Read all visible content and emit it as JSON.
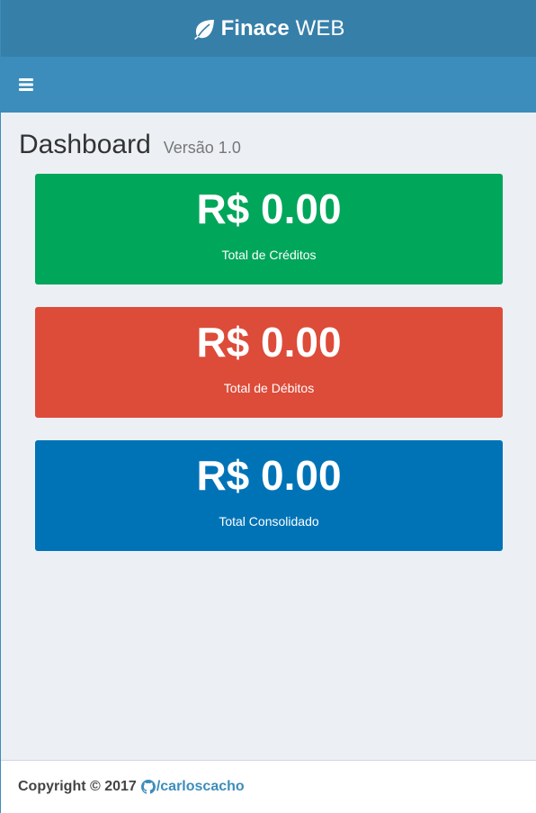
{
  "header": {
    "logo_bold": "Finace",
    "logo_light": "WEB",
    "logo_icon": "leaf-icon",
    "menu_icon": "bars-icon"
  },
  "content": {
    "title": "Dashboard",
    "subtitle": "Versão 1.0"
  },
  "cards": [
    {
      "value": "R$ 0.00",
      "label": "Total de Créditos",
      "color": "#00a65a"
    },
    {
      "value": "R$ 0.00",
      "label": "Total de Débitos",
      "color": "#dd4b39"
    },
    {
      "value": "R$ 0.00",
      "label": "Total Consolidado",
      "color": "#0073b7"
    }
  ],
  "footer": {
    "copyright": "Copyright © 2017",
    "link_text": "/carloscacho",
    "link_icon": "github-icon"
  },
  "colors": {
    "logo_bar": "#367fa9",
    "navbar": "#3c8dbc",
    "background": "#ecf0f5"
  }
}
